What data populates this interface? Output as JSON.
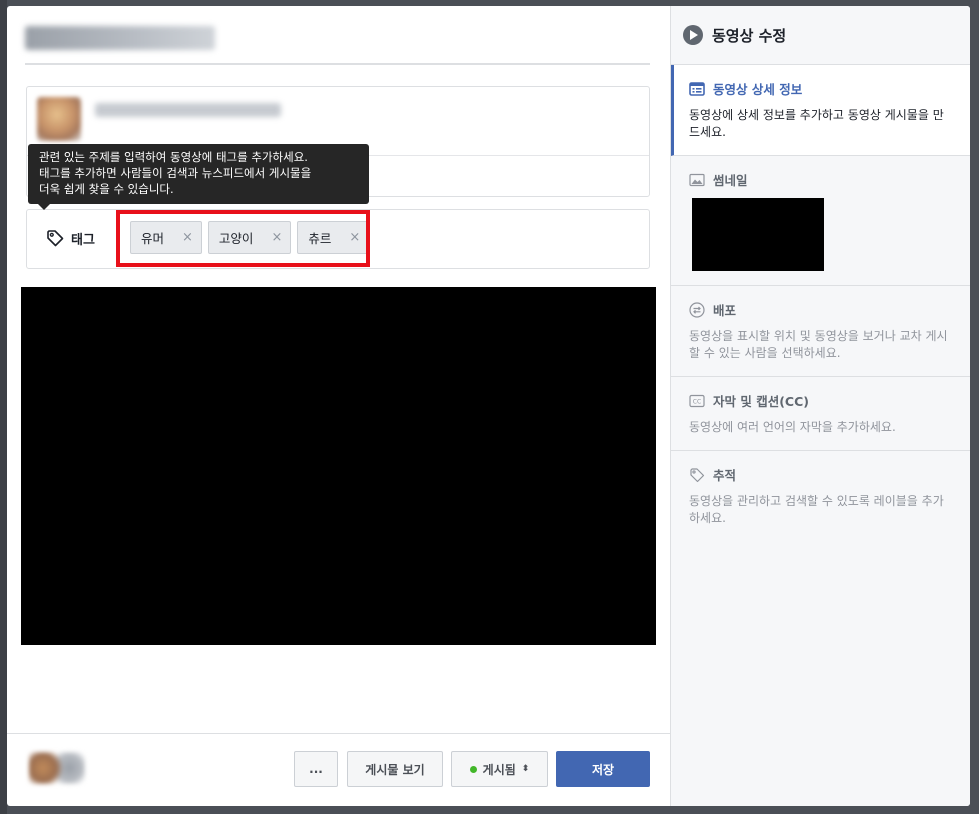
{
  "tooltip": {
    "line1": "관련 있는 주제를 입력하여 동영상에 태그를 추가하세요.",
    "line2": "태그를 추가하면 사람들이 검색과 뉴스피드에서 게시물을",
    "line3": "더욱 쉽게 찾을 수 있습니다."
  },
  "tags": {
    "label": "태그",
    "items": [
      {
        "text": "유머",
        "remove": "×"
      },
      {
        "text": "고양이",
        "remove": "×"
      },
      {
        "text": "츄르",
        "remove": "×"
      }
    ]
  },
  "footer": {
    "more_label": "...",
    "view_post_label": "게시물 보기",
    "status_label": "게시됨",
    "status_arrows": "⬍",
    "save_label": "저장"
  },
  "sidebar": {
    "title": "동영상 수정",
    "sections": [
      {
        "title": "동영상 상세 정보",
        "desc": "동영상에 상세 정보를 추가하고 동영상 게시물을 만드세요."
      },
      {
        "title": "썸네일",
        "desc": ""
      },
      {
        "title": "배포",
        "desc": "동영상을 표시할 위치 및 동영상을 보거나 교차 게시할 수 있는 사람을 선택하세요."
      },
      {
        "title": "자막 및 캡션(CC)",
        "desc": "동영상에 여러 언어의 자막을 추가하세요."
      },
      {
        "title": "추적",
        "desc": "동영상을 관리하고 검색할 수 있도록 레이블을 추가하세요."
      }
    ]
  },
  "colors": {
    "accent": "#4267b2",
    "highlight": "#e8101a",
    "status_dot": "#42b72a"
  }
}
